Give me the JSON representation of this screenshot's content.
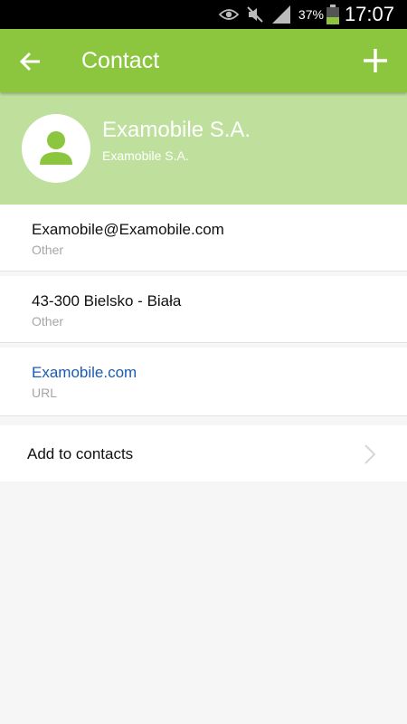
{
  "status_bar": {
    "battery_percent": "37%",
    "time": "17:07",
    "icons": [
      "eye-icon",
      "mute-icon",
      "signal-icon",
      "battery-icon"
    ]
  },
  "app_bar": {
    "title": "Contact",
    "back_icon": "arrow-left-icon",
    "add_icon": "plus-icon"
  },
  "header": {
    "name": "Examobile S.A.",
    "company": "Examobile S.A.",
    "avatar_icon": "person-icon"
  },
  "details": [
    {
      "value": "Examobile@Examobile.com",
      "label": "Other"
    },
    {
      "value": "43-300 Bielsko - Biała",
      "label": "Other"
    },
    {
      "value": "Examobile.com",
      "label": "URL"
    }
  ],
  "actions": {
    "add_to_contacts": "Add to contacts"
  },
  "colors": {
    "app_bar": "#8cc63f",
    "header": "#bfe09d",
    "link": "#1a5cb0",
    "secondary_text": "#a6a6a6",
    "background": "#f6f6f6"
  }
}
